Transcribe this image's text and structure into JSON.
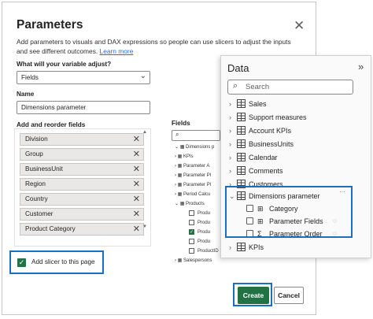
{
  "dialog": {
    "title": "Parameters",
    "close_glyph": "✕",
    "description": "Add parameters to visuals and DAX expressions so people can use slicers to adjust the inputs and see different outcomes.",
    "learn_more": "Learn more",
    "adjust_label": "What will your variable adjust?",
    "adjust_value": "Fields",
    "name_label": "Name",
    "name_value": "Dimensions parameter",
    "add_reorder_label": "Add and reorder fields",
    "items": [
      "Division",
      "Group",
      "BusinessUnit",
      "Region",
      "Country",
      "Customer",
      "Product Category"
    ],
    "add_slicer_label": "Add slicer to this page",
    "add_slicer_checked": true,
    "fields_label": "Fields",
    "fields_tree": [
      "Dimensions p",
      "KPIs",
      "Parameter A",
      "Parameter Pl",
      "Parameter Pl",
      "Period Calcu",
      "Products",
      "Produ",
      "Produ",
      "Produ",
      "Produ",
      "ProductID",
      "Salespersons"
    ],
    "create_label": "Create",
    "cancel_label": "Cancel"
  },
  "data_pane": {
    "title": "Data",
    "collapse_glyph": "»",
    "search_placeholder": "Search",
    "tables_top": [
      "Sales",
      "Support measures",
      "Account KPIs",
      "BusinessUnits",
      "Calendar",
      "Comments",
      "Customers"
    ],
    "expanded_table": "Dimensions parameter",
    "more_glyph": "···",
    "expanded_fields": [
      "Category",
      "Parameter Fields",
      "Parameter Order"
    ],
    "tables_bottom": [
      "KPIs"
    ]
  },
  "colors": {
    "accent_green": "#217346",
    "highlight_blue": "#1b6ec2",
    "link": "#1a73e8"
  },
  "icons": {
    "close": "close-icon",
    "chevron": "chevron-down-icon",
    "search": "search-icon",
    "table": "table-icon",
    "remove": "remove-icon",
    "hidden": "eye-off-icon"
  }
}
